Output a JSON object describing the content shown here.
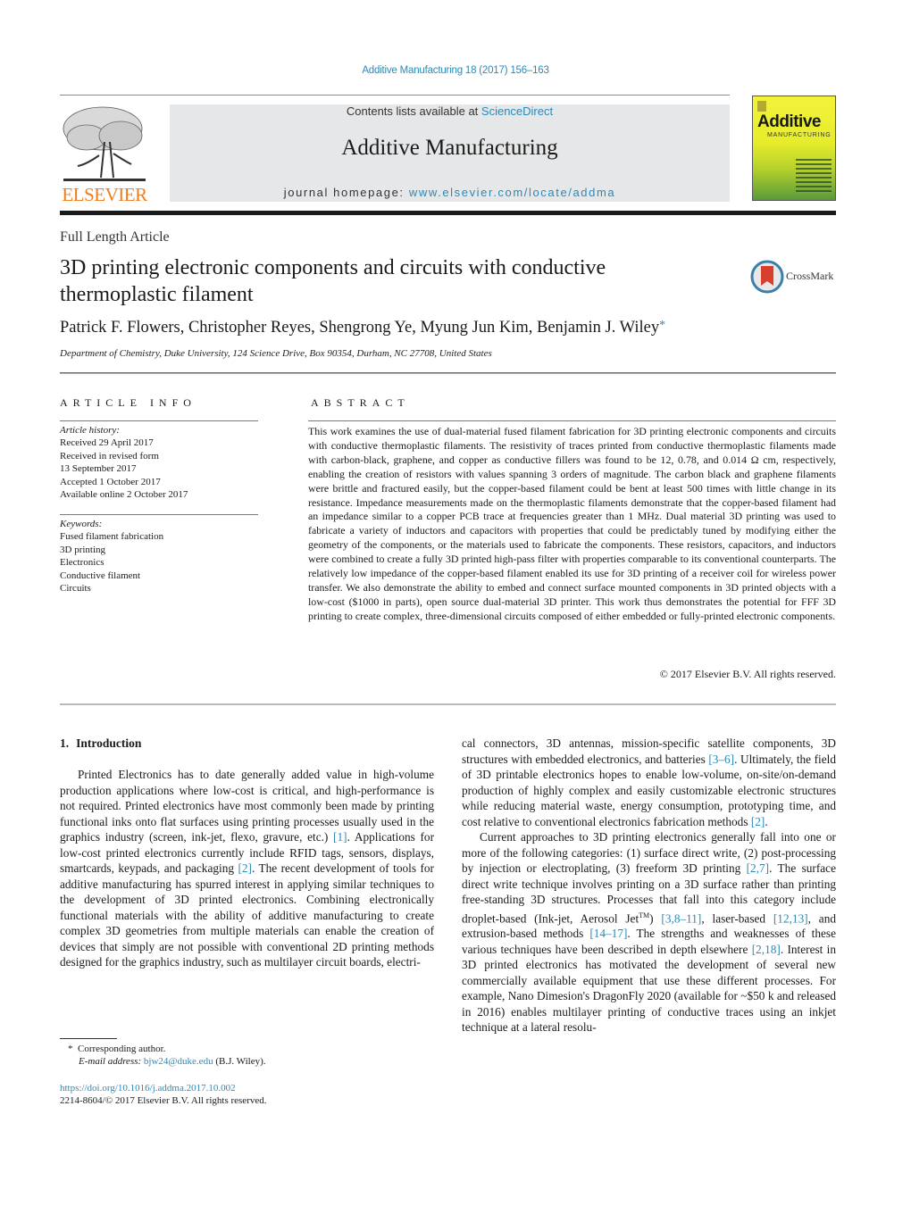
{
  "header": {
    "journal_ref": "Additive Manufacturing 18 (2017) 156–163",
    "contents_prefix": "Contents lists available at ",
    "contents_link": "ScienceDirect",
    "journal_title": "Additive Manufacturing",
    "homepage_prefix": "journal homepage: ",
    "homepage_link": "www.elsevier.com/locate/addma",
    "publisher_logo": "ELSEVIER",
    "cover": {
      "title": "Additive",
      "subtitle": "MANUFACTURING",
      "colors": {
        "top": "#f3f33a",
        "bottom": "#5a9a3a"
      }
    },
    "accent_color": "#2a8ab8",
    "publisher_color": "#f07d1a"
  },
  "article": {
    "type": "Full Length Article",
    "title": "3D printing electronic components and circuits with conductive thermoplastic filament",
    "crossmark_label": "CrossMark",
    "authors": "Patrick F. Flowers, Christopher Reyes, Shengrong Ye, Myung Jun Kim, Benjamin J. Wiley",
    "corresponding_marker": "*",
    "affiliation": "Department of Chemistry, Duke University, 124 Science Drive, Box 90354, Durham, NC 27708, United States"
  },
  "article_info": {
    "heading": "ARTICLE INFO",
    "history_label": "Article history:",
    "history": [
      "Received 29 April 2017",
      "Received in revised form",
      "13 September 2017",
      "Accepted 1 October 2017",
      "Available online 2 October 2017"
    ],
    "keywords_label": "Keywords:",
    "keywords": [
      "Fused filament fabrication",
      "3D printing",
      "Electronics",
      "Conductive filament",
      "Circuits"
    ]
  },
  "abstract": {
    "heading": "ABSTRACT",
    "text": "This work examines the use of dual-material fused filament fabrication for 3D printing electronic components and circuits with conductive thermoplastic filaments. The resistivity of traces printed from conductive thermoplastic filaments made with carbon-black, graphene, and copper as conductive fillers was found to be 12, 0.78, and 0.014 Ω cm, respectively, enabling the creation of resistors with values spanning 3 orders of magnitude. The carbon black and graphene filaments were brittle and fractured easily, but the copper-based filament could be bent at least 500 times with little change in its resistance. Impedance measurements made on the thermoplastic filaments demonstrate that the copper-based filament had an impedance similar to a copper PCB trace at frequencies greater than 1 MHz. Dual material 3D printing was used to fabricate a variety of inductors and capacitors with properties that could be predictably tuned by modifying either the geometry of the components, or the materials used to fabricate the components. These resistors, capacitors, and inductors were combined to create a fully 3D printed high-pass filter with properties comparable to its conventional counterparts. The relatively low impedance of the copper-based filament enabled its use for 3D printing of a receiver coil for wireless power transfer. We also demonstrate the ability to embed and connect surface mounted components in 3D printed objects with a low-cost ($1000 in parts), open source dual-material 3D printer. This work thus demonstrates the potential for FFF 3D printing to create complex, three-dimensional circuits composed of either embedded or fully-printed electronic components.",
    "copyright": "© 2017 Elsevier B.V. All rights reserved."
  },
  "introduction": {
    "number": "1.",
    "heading": "Introduction",
    "left_col": {
      "p1_a": "Printed Electronics has to date generally added value in high-volume production applications where low-cost is critical, and high-performance is not required. Printed electronics have most commonly been made by printing functional inks onto flat surfaces using printing processes usually used in the graphics industry (screen, ink-jet, flexo, gravure, etc.) ",
      "ref1": "[1]",
      "p1_b": ". Applications for low-cost printed electronics currently include RFID tags, sensors, displays, smartcards, keypads, and packaging ",
      "ref2": "[2]",
      "p1_c": ". The recent development of tools for additive manufacturing has spurred interest in applying similar techniques to the development of 3D printed electronics. Combining electronically functional materials with the ability of additive manufacturing to create complex 3D geometries from multiple materials can enable the creation of devices that simply are not possible with conventional 2D printing methods designed for the graphics industry, such as multilayer circuit boards, electri-"
    },
    "right_col": {
      "p1_a": "cal connectors, 3D antennas, mission-specific satellite components, 3D structures with embedded electronics, and batteries ",
      "ref_3_6": "[3–6]",
      "p1_b": ". Ultimately, the field of 3D printable electronics hopes to enable low-volume, on-site/on-demand production of highly complex and easily customizable electronic structures while reducing material waste, energy consumption, prototyping time, and cost relative to conventional electronics fabrication methods ",
      "ref2": "[2]",
      "p1_c": ".",
      "p2_a": "Current approaches to 3D printing electronics generally fall into one or more of the following categories: (1) surface direct write, (2) post-processing by injection or electroplating, (3) freeform 3D printing ",
      "ref_2_7": "[2,7]",
      "p2_b": ". The surface direct write technique involves printing on a 3D surface rather than printing free-standing 3D structures. Processes that fall into this category include droplet-based (Ink-jet, Aerosol Jet",
      "tm": "TM",
      "p2_c": ") ",
      "ref_3_8_11": "[3,8–11]",
      "p2_d": ", laser-based ",
      "ref_12_13": "[12,13]",
      "p2_e": ", and extrusion-based methods ",
      "ref_14_17": "[14–17]",
      "p2_f": ". The strengths and weaknesses of these various techniques have been described in depth elsewhere ",
      "ref_2_18": "[2,18]",
      "p2_g": ". Interest in 3D printed electronics has motivated the development of several new commercially available equipment that use these different processes. For example, Nano Dimesion's DragonFly 2020 (available for ~$50 k and released in 2016) enables multilayer printing of conductive traces using an inkjet technique at a lateral resolu-"
    }
  },
  "footnotes": {
    "marker": "*",
    "corresponding": "Corresponding author.",
    "email_label": "E-mail address: ",
    "email": "bjw24@duke.edu",
    "email_suffix": " (B.J. Wiley).",
    "doi": "https://doi.org/10.1016/j.addma.2017.10.002",
    "issn_copyright": "2214-8604/© 2017 Elsevier B.V. All rights reserved."
  }
}
